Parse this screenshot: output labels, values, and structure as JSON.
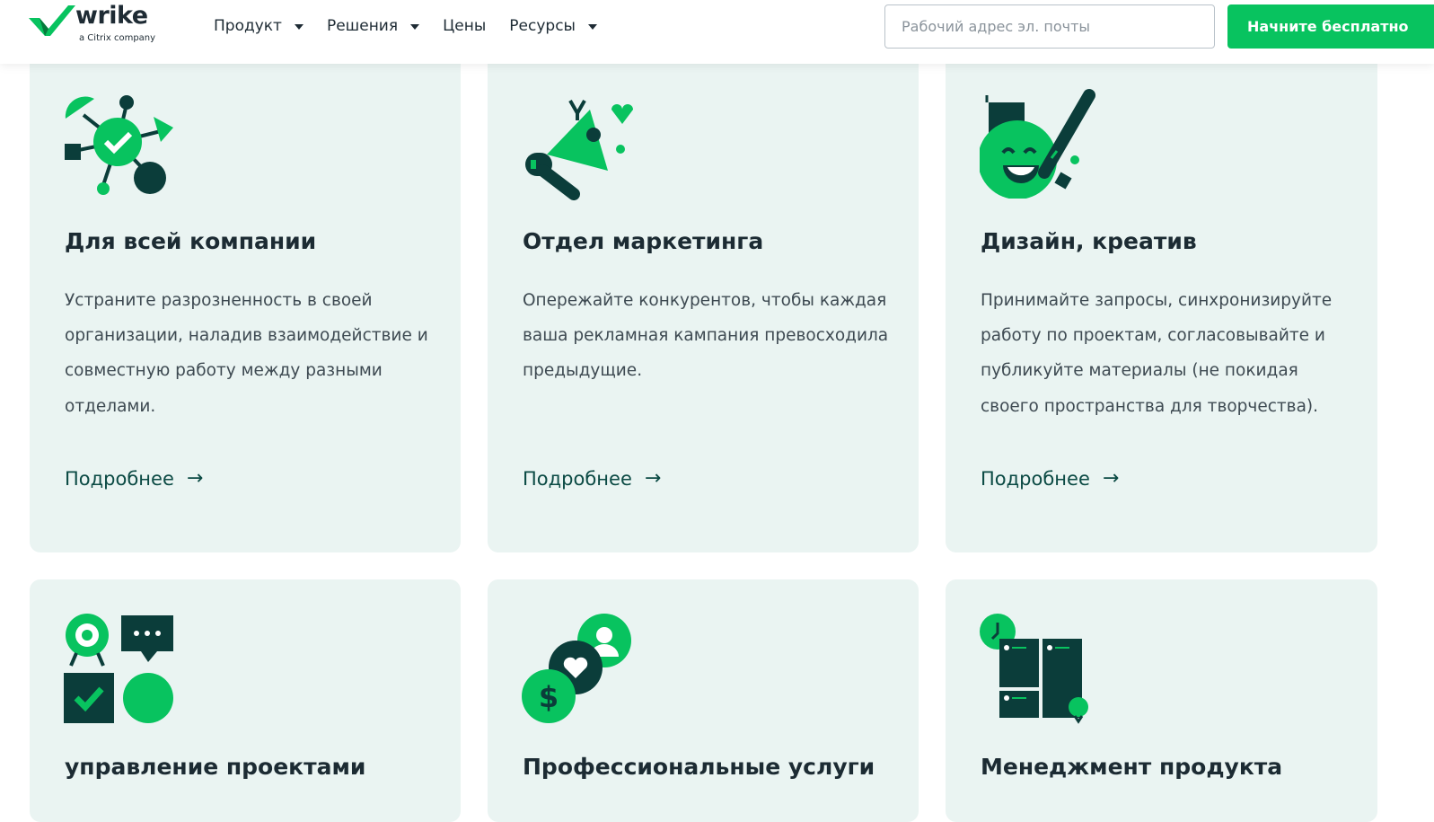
{
  "header": {
    "logo_text": "wrike",
    "logo_sub": "a Citrix company",
    "nav": [
      {
        "label": "Продукт",
        "has_dropdown": true
      },
      {
        "label": "Решения",
        "has_dropdown": true
      },
      {
        "label": "Цены",
        "has_dropdown": false
      },
      {
        "label": "Ресурсы",
        "has_dropdown": true
      }
    ],
    "email_placeholder": "Рабочий адрес эл. почты",
    "cta_label": "Начните бесплатно"
  },
  "cards": [
    {
      "title": "Для всей компании",
      "icon": "network-hub-icon",
      "desc": "Устраните разрозненность в своей организации, наладив взаимодействие и совместную работу между разными отделами.",
      "link": "Подробнее"
    },
    {
      "title": "Отдел маркетинга",
      "icon": "megaphone-icon",
      "desc": "Опережайте конкурентов, чтобы каждая ваша рекламная кампания превосходила предыдущие.",
      "link": "Подробнее"
    },
    {
      "title": "Дизайн, креатив",
      "icon": "smiley-pen-icon",
      "desc": "Принимайте запросы, синхронизируйте работу по проектам, согласовывайте и публикуйте материалы (не покидая своего пространства для творчества).",
      "link": "Подробнее"
    },
    {
      "title": "управление проектами",
      "icon": "project-blocks-icon"
    },
    {
      "title": "Профессиональные услуги",
      "icon": "services-coins-icon"
    },
    {
      "title": "Менеджмент продукта",
      "icon": "product-board-icon"
    }
  ],
  "colors": {
    "accent": "#08c35f",
    "dark": "#0b3d3a",
    "card_bg": "#eaf4f2"
  }
}
